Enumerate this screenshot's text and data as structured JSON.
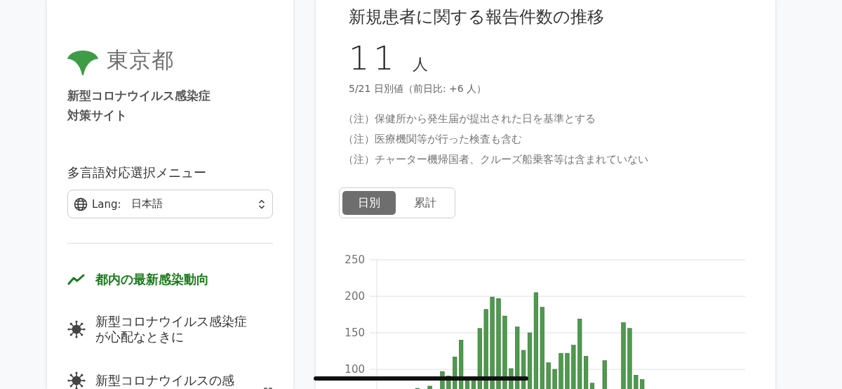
{
  "logo": {
    "text": "東京都"
  },
  "site_title": [
    "新型コロナウイルス感染症",
    "対策サイト"
  ],
  "language_menu": {
    "label": "多言語対応選択メニュー",
    "prefix": "Lang:",
    "value": "日本語"
  },
  "nav": {
    "items": [
      {
        "kind": "trend",
        "lines": [
          "都内の最新感染動向"
        ],
        "selected": true,
        "external": false
      },
      {
        "kind": "virus",
        "lines": [
          "新型コロナウイルス感染症",
          "が心配なときに"
        ],
        "selected": false,
        "external": false
      },
      {
        "kind": "virus",
        "lines": [
          "新型コロナウイルスの感"
        ],
        "selected": false,
        "external": true
      }
    ]
  },
  "card": {
    "title": "新規患者に関する報告件数の推移",
    "value": "11",
    "unit": "人",
    "date_note": "5/21 日別値（前日比: +6 人）",
    "notes": [
      "（注）保健所から発生届が提出された日を基準とする",
      "（注）医療機関等が行った検査も含む",
      "（注）チャーター機帰国者、クルーズ船乗客等は含まれていない"
    ],
    "toggle": [
      {
        "label": "日別",
        "selected": true
      },
      {
        "label": "累計",
        "selected": false
      }
    ],
    "chart_data": {
      "type": "bar",
      "grid": true,
      "ylim": [
        0,
        250
      ],
      "yticks": [
        100,
        150,
        200,
        250
      ],
      "series": [
        {
          "color": "#4e9a4e",
          "values": [
            null,
            null,
            null,
            null,
            null,
            null,
            74,
            null,
            77,
            null,
            97,
            91,
            117,
            140,
            86,
            86,
            156,
            182,
            199,
            197,
            173,
            101,
            158,
            126,
            150,
            205,
            185,
            109,
            100,
            122,
            122,
            133,
            169,
            118,
            81,
            null,
            112,
            null,
            null,
            164,
            156,
            92,
            86,
            null,
            null,
            null,
            null,
            null,
            null,
            null,
            null,
            null,
            null,
            null,
            null,
            null,
            null,
            null,
            null
          ]
        }
      ]
    }
  }
}
